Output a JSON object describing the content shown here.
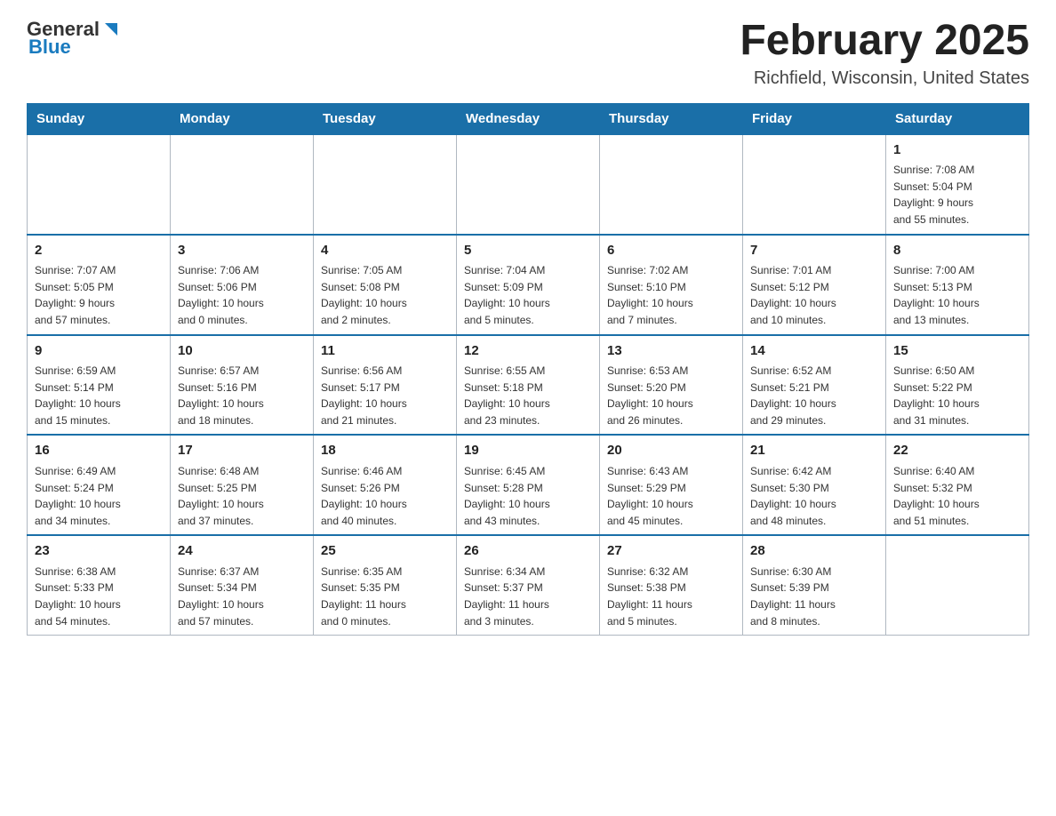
{
  "header": {
    "logo": {
      "general": "General",
      "blue": "Blue"
    },
    "title": "February 2025",
    "location": "Richfield, Wisconsin, United States"
  },
  "weekdays": [
    "Sunday",
    "Monday",
    "Tuesday",
    "Wednesday",
    "Thursday",
    "Friday",
    "Saturday"
  ],
  "weeks": [
    [
      {
        "day": "",
        "info": ""
      },
      {
        "day": "",
        "info": ""
      },
      {
        "day": "",
        "info": ""
      },
      {
        "day": "",
        "info": ""
      },
      {
        "day": "",
        "info": ""
      },
      {
        "day": "",
        "info": ""
      },
      {
        "day": "1",
        "info": "Sunrise: 7:08 AM\nSunset: 5:04 PM\nDaylight: 9 hours\nand 55 minutes."
      }
    ],
    [
      {
        "day": "2",
        "info": "Sunrise: 7:07 AM\nSunset: 5:05 PM\nDaylight: 9 hours\nand 57 minutes."
      },
      {
        "day": "3",
        "info": "Sunrise: 7:06 AM\nSunset: 5:06 PM\nDaylight: 10 hours\nand 0 minutes."
      },
      {
        "day": "4",
        "info": "Sunrise: 7:05 AM\nSunset: 5:08 PM\nDaylight: 10 hours\nand 2 minutes."
      },
      {
        "day": "5",
        "info": "Sunrise: 7:04 AM\nSunset: 5:09 PM\nDaylight: 10 hours\nand 5 minutes."
      },
      {
        "day": "6",
        "info": "Sunrise: 7:02 AM\nSunset: 5:10 PM\nDaylight: 10 hours\nand 7 minutes."
      },
      {
        "day": "7",
        "info": "Sunrise: 7:01 AM\nSunset: 5:12 PM\nDaylight: 10 hours\nand 10 minutes."
      },
      {
        "day": "8",
        "info": "Sunrise: 7:00 AM\nSunset: 5:13 PM\nDaylight: 10 hours\nand 13 minutes."
      }
    ],
    [
      {
        "day": "9",
        "info": "Sunrise: 6:59 AM\nSunset: 5:14 PM\nDaylight: 10 hours\nand 15 minutes."
      },
      {
        "day": "10",
        "info": "Sunrise: 6:57 AM\nSunset: 5:16 PM\nDaylight: 10 hours\nand 18 minutes."
      },
      {
        "day": "11",
        "info": "Sunrise: 6:56 AM\nSunset: 5:17 PM\nDaylight: 10 hours\nand 21 minutes."
      },
      {
        "day": "12",
        "info": "Sunrise: 6:55 AM\nSunset: 5:18 PM\nDaylight: 10 hours\nand 23 minutes."
      },
      {
        "day": "13",
        "info": "Sunrise: 6:53 AM\nSunset: 5:20 PM\nDaylight: 10 hours\nand 26 minutes."
      },
      {
        "day": "14",
        "info": "Sunrise: 6:52 AM\nSunset: 5:21 PM\nDaylight: 10 hours\nand 29 minutes."
      },
      {
        "day": "15",
        "info": "Sunrise: 6:50 AM\nSunset: 5:22 PM\nDaylight: 10 hours\nand 31 minutes."
      }
    ],
    [
      {
        "day": "16",
        "info": "Sunrise: 6:49 AM\nSunset: 5:24 PM\nDaylight: 10 hours\nand 34 minutes."
      },
      {
        "day": "17",
        "info": "Sunrise: 6:48 AM\nSunset: 5:25 PM\nDaylight: 10 hours\nand 37 minutes."
      },
      {
        "day": "18",
        "info": "Sunrise: 6:46 AM\nSunset: 5:26 PM\nDaylight: 10 hours\nand 40 minutes."
      },
      {
        "day": "19",
        "info": "Sunrise: 6:45 AM\nSunset: 5:28 PM\nDaylight: 10 hours\nand 43 minutes."
      },
      {
        "day": "20",
        "info": "Sunrise: 6:43 AM\nSunset: 5:29 PM\nDaylight: 10 hours\nand 45 minutes."
      },
      {
        "day": "21",
        "info": "Sunrise: 6:42 AM\nSunset: 5:30 PM\nDaylight: 10 hours\nand 48 minutes."
      },
      {
        "day": "22",
        "info": "Sunrise: 6:40 AM\nSunset: 5:32 PM\nDaylight: 10 hours\nand 51 minutes."
      }
    ],
    [
      {
        "day": "23",
        "info": "Sunrise: 6:38 AM\nSunset: 5:33 PM\nDaylight: 10 hours\nand 54 minutes."
      },
      {
        "day": "24",
        "info": "Sunrise: 6:37 AM\nSunset: 5:34 PM\nDaylight: 10 hours\nand 57 minutes."
      },
      {
        "day": "25",
        "info": "Sunrise: 6:35 AM\nSunset: 5:35 PM\nDaylight: 11 hours\nand 0 minutes."
      },
      {
        "day": "26",
        "info": "Sunrise: 6:34 AM\nSunset: 5:37 PM\nDaylight: 11 hours\nand 3 minutes."
      },
      {
        "day": "27",
        "info": "Sunrise: 6:32 AM\nSunset: 5:38 PM\nDaylight: 11 hours\nand 5 minutes."
      },
      {
        "day": "28",
        "info": "Sunrise: 6:30 AM\nSunset: 5:39 PM\nDaylight: 11 hours\nand 8 minutes."
      },
      {
        "day": "",
        "info": ""
      }
    ]
  ]
}
